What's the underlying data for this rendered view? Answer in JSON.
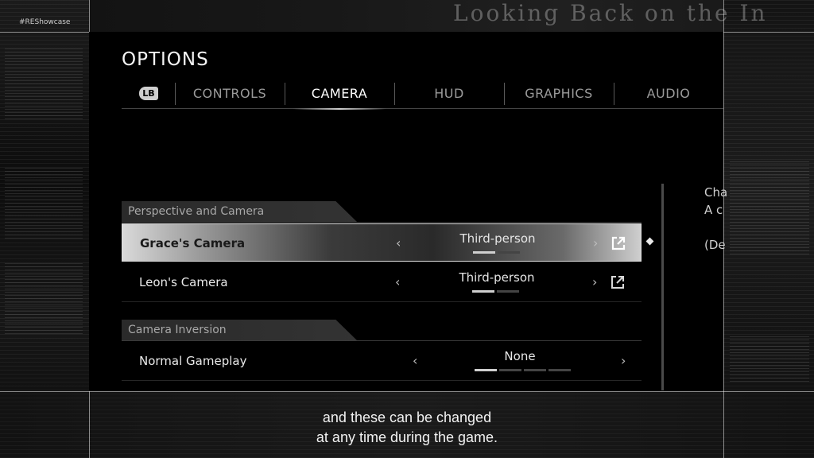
{
  "overlay": {
    "hashtag": "#REShowcase",
    "headline": "Looking Back on the In"
  },
  "options": {
    "title": "OPTIONS",
    "bumper_label": "LB",
    "tabs": [
      {
        "label": "CONTROLS",
        "active": false
      },
      {
        "label": "CAMERA",
        "active": true
      },
      {
        "label": "HUD",
        "active": false
      },
      {
        "label": "GRAPHICS",
        "active": false
      },
      {
        "label": "AUDIO",
        "active": false
      }
    ]
  },
  "sections": [
    {
      "header": "Perspective and Camera",
      "rows": [
        {
          "label": "Grace's Camera",
          "value": "Third-person",
          "selected": true,
          "steps_total": 2,
          "steps_active": 1,
          "external_link": true
        },
        {
          "label": "Leon's Camera",
          "value": "Third-person",
          "selected": false,
          "steps_total": 2,
          "steps_active": 1,
          "external_link": true
        }
      ]
    },
    {
      "header": "Camera Inversion",
      "rows": [
        {
          "label": "Normal Gameplay",
          "value": "None",
          "selected": false,
          "steps_total": 4,
          "steps_active": 1,
          "external_link": false
        }
      ]
    }
  ],
  "arrows": {
    "left": "‹",
    "right": "›"
  },
  "description": {
    "line1": "Cha",
    "line2": "A c",
    "line3": "(De"
  },
  "subtitle": {
    "line1": "and these can be changed",
    "line2": "at any time during the game."
  }
}
